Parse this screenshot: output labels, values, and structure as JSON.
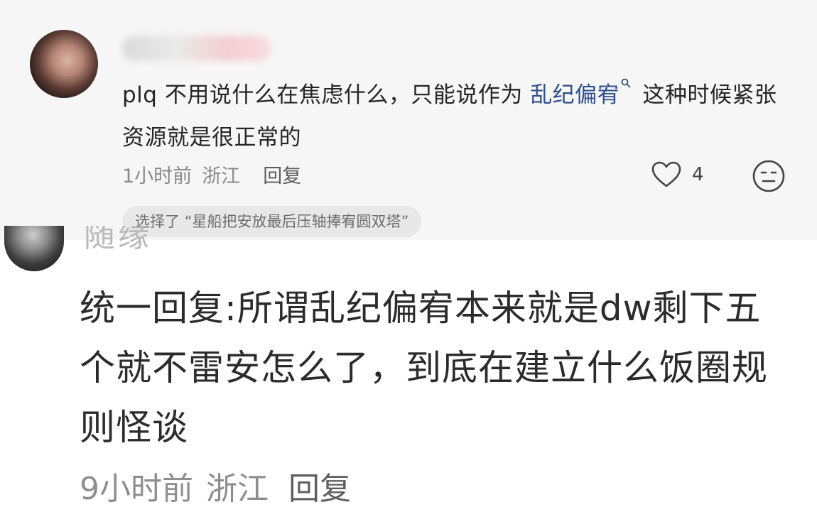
{
  "comment_1": {
    "body_prefix": "plq 不用说什么在焦虑什么，只能说作为 ",
    "body_keyword": "乱纪偏宥",
    "body_suffix": " 这种时候紧张资源就是很正常的",
    "time": "1小时前",
    "location": "浙江",
    "reply_label": "回复",
    "like_count": "4",
    "choice_chip": "选择了 “星船把安放最后压轴捧宥圆双塔”"
  },
  "comment_2": {
    "username_partial": "随缘",
    "body": "统一回复:所谓乱纪偏宥本来就是dw剩下五个就不雷安怎么了，到底在建立什么饭圈规则怪谈",
    "time": "9小时前",
    "location": "浙江",
    "reply_label": "回复"
  },
  "colors": {
    "keyword": "#2f4f8a",
    "panel_bg": "#f6f6f6",
    "meta": "#8a8a8a"
  }
}
